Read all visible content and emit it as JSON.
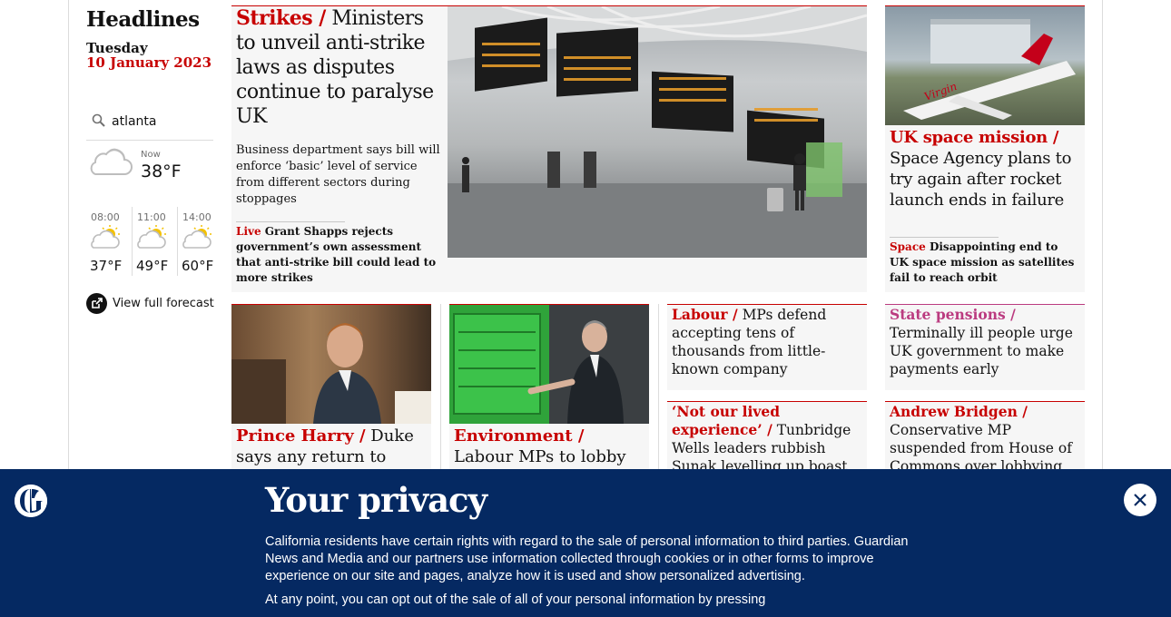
{
  "sidebar": {
    "title": "Headlines",
    "day": "Tuesday",
    "date": "10 January 2023",
    "search": {
      "value": "atlanta"
    },
    "weather": {
      "now_label": "Now",
      "now_temp": "38°F",
      "now_icon": "cloudy-icon",
      "forecast": [
        {
          "time": "08:00",
          "temp": "37°F",
          "icon": "partly-sunny-icon"
        },
        {
          "time": "11:00",
          "temp": "49°F",
          "icon": "partly-sunny-icon"
        },
        {
          "time": "14:00",
          "temp": "60°F",
          "icon": "partly-sunny-icon"
        }
      ],
      "full_forecast_label": "View full forecast"
    }
  },
  "lead": {
    "kicker": "Strikes /",
    "headline": "Ministers to unveil anti-strike laws as disputes continue to paralyse UK",
    "standfirst": "Business department says bill will enforce ‘basic’ level of service from different sectors during stoppages",
    "sublink_live": "Live",
    "sublink_text": "Grant Shapps rejects government’s own assessment that anti-strike bill could lead to more strikes"
  },
  "space": {
    "kicker": "UK space mission /",
    "headline": "Space Agency plans to try again after rocket launch ends in failure",
    "sub_kicker": "Space",
    "sub_text": "Disappointing end to UK space mission as satellites fail to reach orbit",
    "image_livery": "Virgin"
  },
  "row2": [
    {
      "kicker": "Prince Harry /",
      "headline": "Duke says any return to royal"
    },
    {
      "kicker": "Environment /",
      "headline": "Labour MPs to lobby Keir"
    },
    {
      "kicker": "Labour /",
      "headline": "MPs defend accepting tens of thousands from little-known company"
    },
    {
      "kicker": "State pensions /",
      "headline": "Terminally ill people urge UK government to make payments early"
    },
    {
      "kicker": "‘Not our lived experience’ /",
      "headline": "Tunbridge Wells leaders rubbish Sunak levelling up boast"
    },
    {
      "kicker": "Andrew Bridgen /",
      "headline": "Conservative MP suspended from House of Commons over lobbying"
    }
  ],
  "privacy": {
    "title": "Your privacy",
    "body": "California residents have certain rights with regard to the sale of personal information to third parties. Guardian News and Media and our partners use information collected through cookies or in other forms to improve experience on our site and pages, analyze how it is used and show personalized advertising.",
    "body_cut": "At any point, you can opt out of the sale of all of your personal information by pressing"
  },
  "colors": {
    "news_red": "#c70000",
    "lifestyle_pink": "#bb3b80",
    "banner_blue": "#052962",
    "card_bg": "#f6f6f6"
  }
}
